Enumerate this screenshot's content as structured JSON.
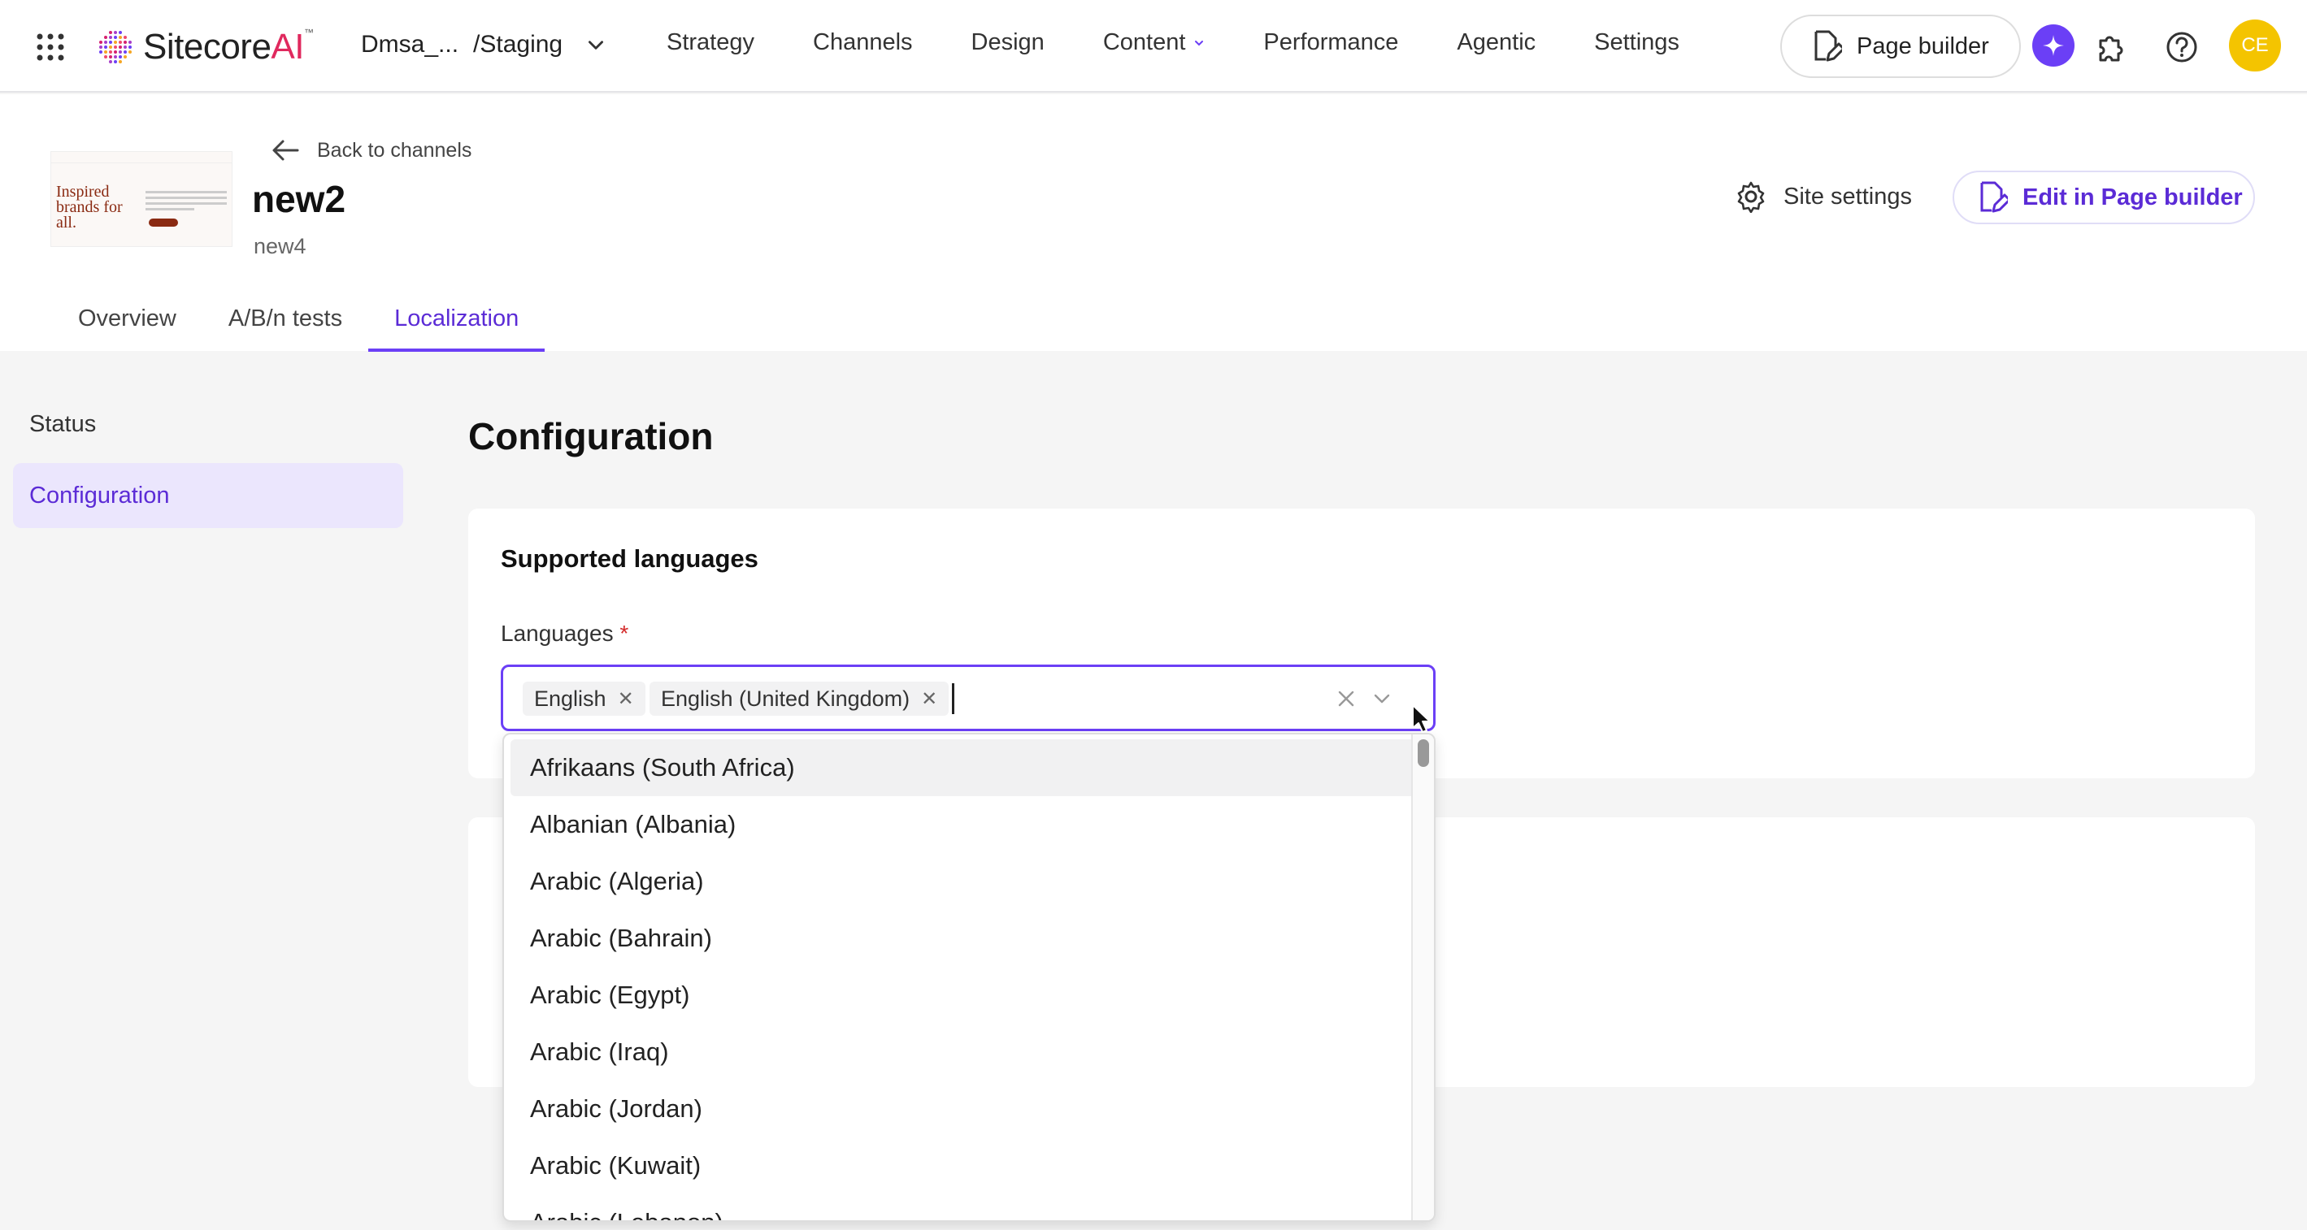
{
  "topbar": {
    "logo_text": "Sitecore",
    "logo_ai": "AI",
    "logo_tm": "™",
    "env_name": "Dmsa_...",
    "env_stage": "/Staging",
    "nav": [
      "Strategy",
      "Channels",
      "Design",
      "Content",
      "Performance",
      "Agentic",
      "Settings"
    ],
    "page_builder_label": "Page builder",
    "avatar_initials": "CE",
    "accent_color": "#6b3ff6",
    "avatar_color": "#f4c400"
  },
  "header": {
    "back_label": "Back to channels",
    "site_name": "new2",
    "site_sub": "new4",
    "thumbnail_headline": "Inspired brands for all.",
    "site_settings_label": "Site settings",
    "edit_label": "Edit in Page builder",
    "tabs": [
      "Overview",
      "A/B/n tests",
      "Localization"
    ],
    "active_tab": "Localization"
  },
  "sidebar": {
    "items": [
      "Status",
      "Configuration"
    ],
    "active": "Configuration"
  },
  "main": {
    "title": "Configuration",
    "card_title": "Supported languages",
    "field_label": "Languages",
    "required_mark": "*",
    "selected": [
      "English",
      "English (United Kingdom)"
    ],
    "options": [
      "Afrikaans (South Africa)",
      "Albanian (Albania)",
      "Arabic (Algeria)",
      "Arabic (Bahrain)",
      "Arabic (Egypt)",
      "Arabic (Iraq)",
      "Arabic (Jordan)",
      "Arabic (Kuwait)",
      "Arabic (Lebanon)"
    ],
    "highlighted_option": "Afrikaans (South Africa)"
  }
}
